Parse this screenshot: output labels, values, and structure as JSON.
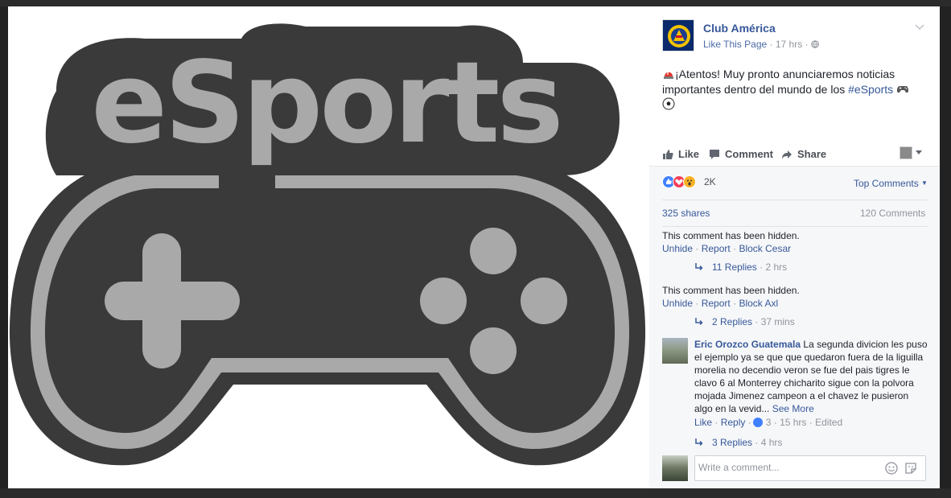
{
  "post": {
    "page_name": "Club América",
    "like_page_label": "Like This Page",
    "separator": "·",
    "time": "17 hrs",
    "text_before_hashtag": "¡Atentos! Muy pronto anunciaremos noticias importantes dentro del mundo de los ",
    "hashtag": "#eSports",
    "image_text": "eSports"
  },
  "actions": {
    "like_label": "Like",
    "comment_label": "Comment",
    "share_label": "Share"
  },
  "stats": {
    "reactions_count": "2K",
    "top_comments_label": "Top Comments",
    "shares": "325 shares",
    "comments": "120 Comments"
  },
  "hidden_comments": [
    {
      "message": "This comment has been hidden.",
      "unhide": "Unhide",
      "report": "Report",
      "block": "Block Cesar",
      "replies": "11 Replies",
      "time": "2 hrs"
    },
    {
      "message": "This comment has been hidden.",
      "unhide": "Unhide",
      "report": "Report",
      "block": "Block Axl",
      "replies": "2 Replies",
      "time": "37 mins"
    }
  ],
  "comment": {
    "author": "Eric Orozco Guatemala",
    "text": "La segunda divicion les puso el ejemplo ya se que que quedaron fuera de la liguilla morelia no decendio veron se fue del pais tigres le clavo 6 al Monterrey chicharito sigue con la polvora mojada Jimenez campeon a el chavez le pusieron algo en la vevid...",
    "see_more": "See More",
    "like": "Like",
    "reply": "Reply",
    "likes": "3",
    "time": "15 hrs",
    "edited": "Edited",
    "replies": "3 Replies",
    "replies_time": "4 hrs"
  },
  "composer": {
    "placeholder": "Write a comment..."
  },
  "colors": {
    "link": "#365899",
    "muted": "#90949c",
    "controller_dark": "#3a3a3a",
    "controller_light": "#a9a9a9"
  }
}
